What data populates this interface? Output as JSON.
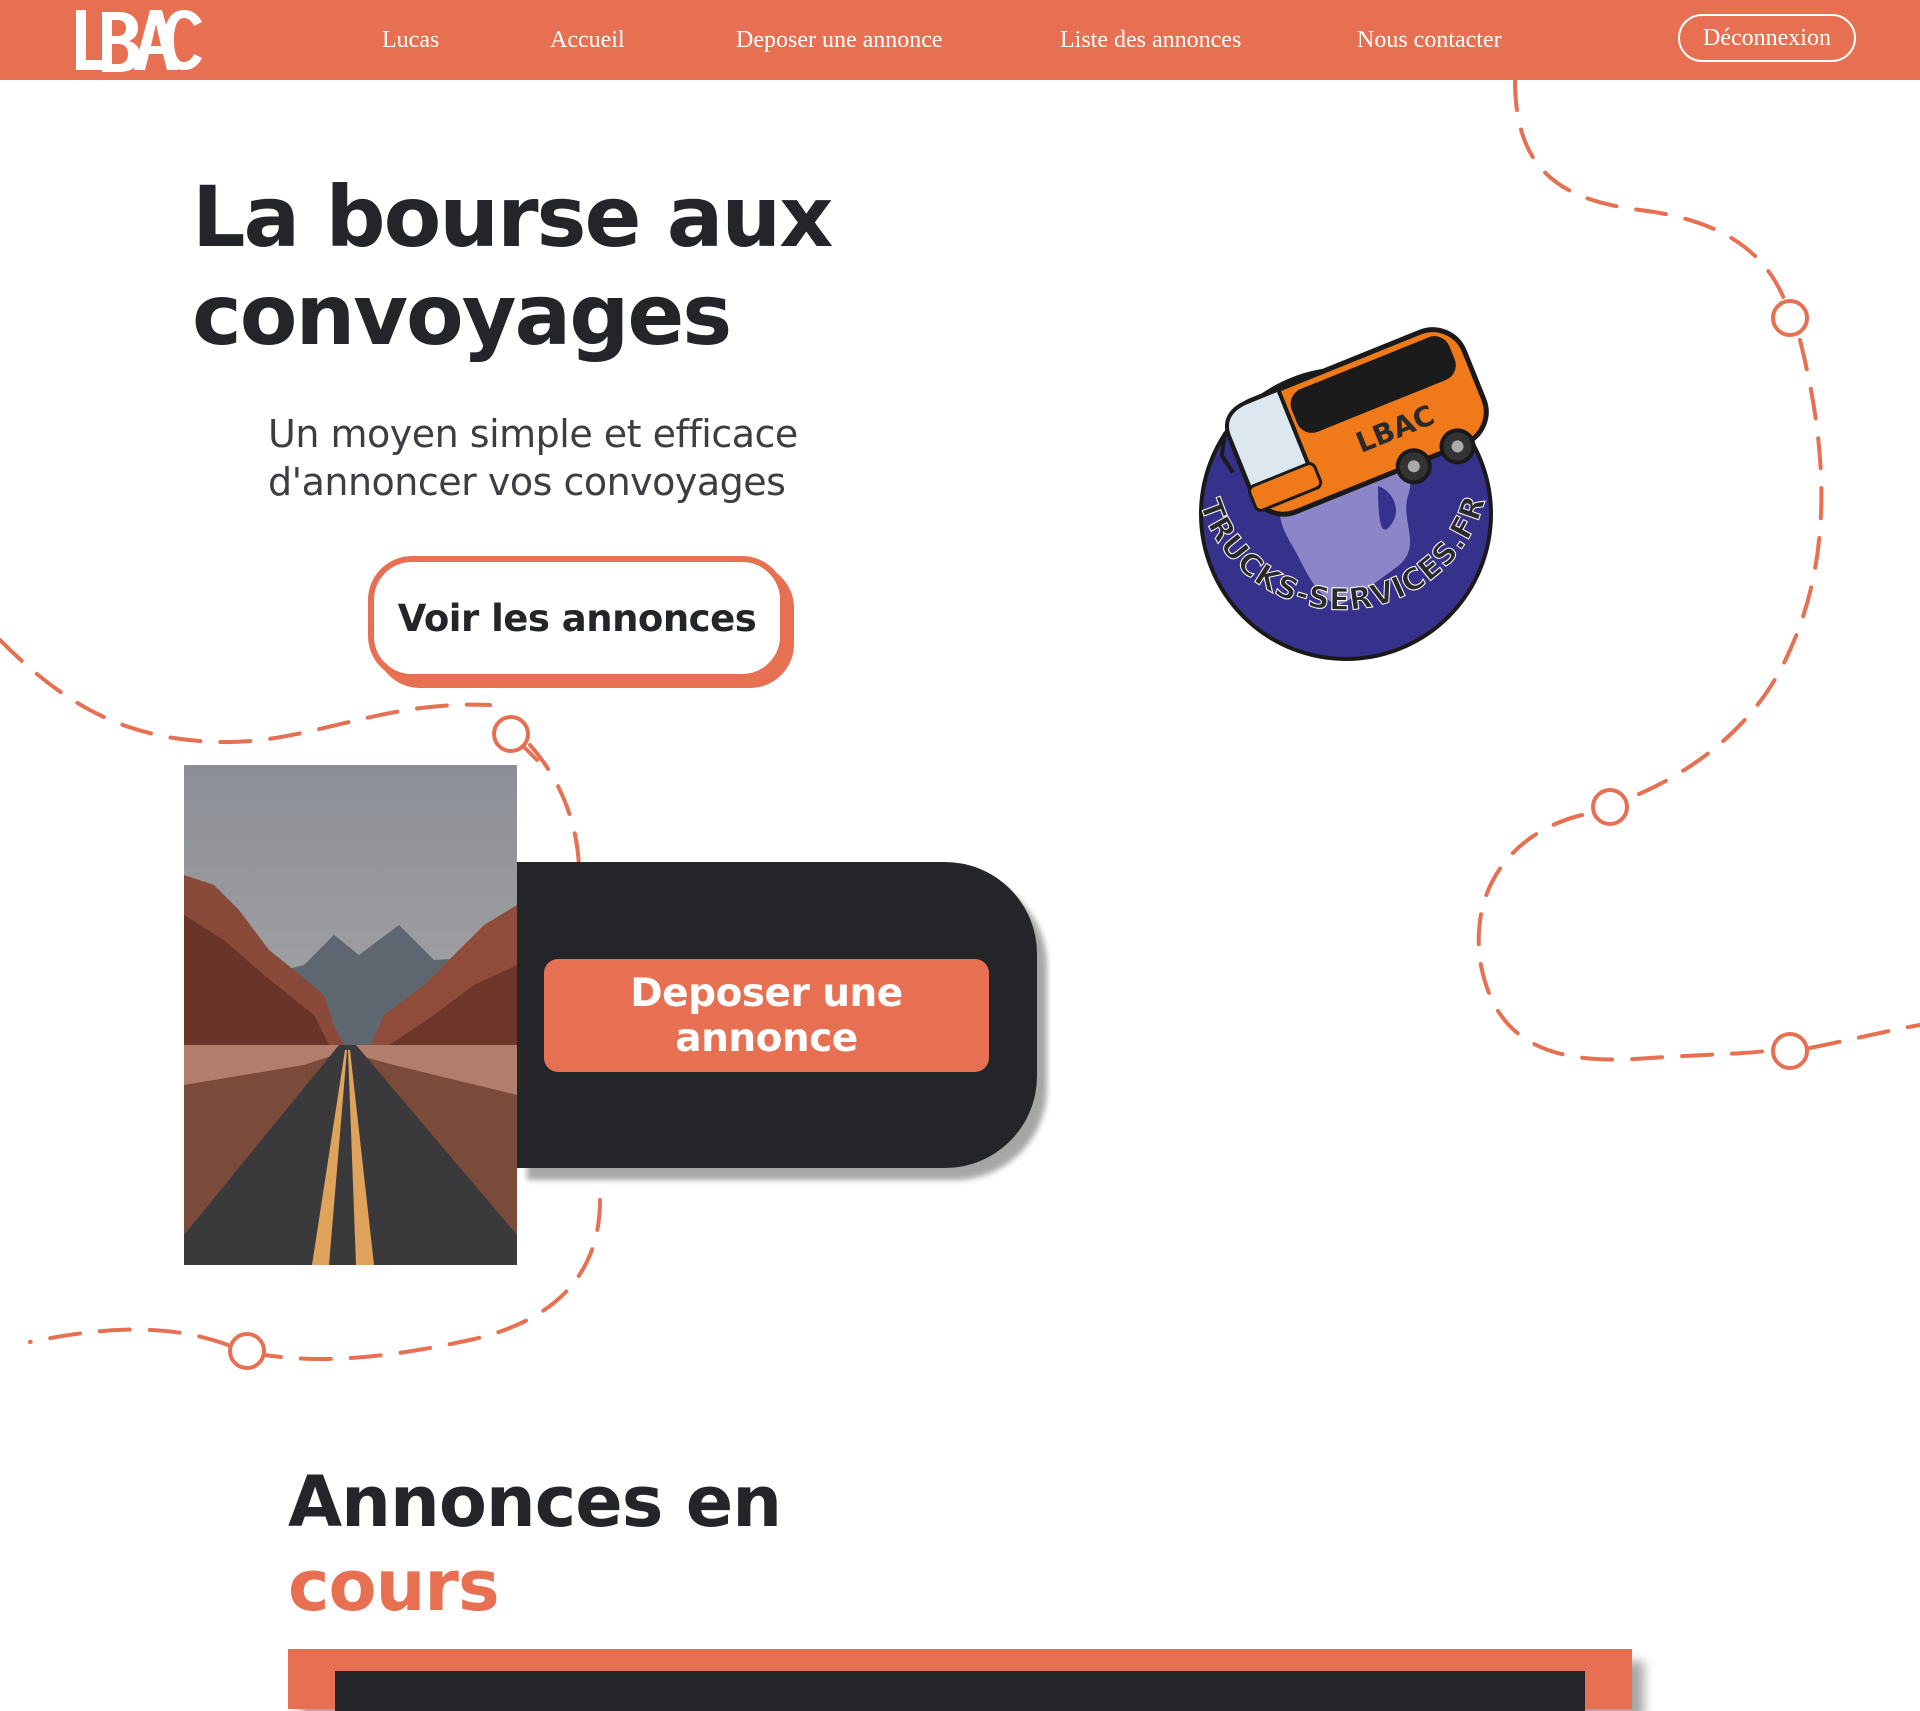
{
  "colors": {
    "accent": "#e67051",
    "dark": "#232528",
    "background": "#ffffff",
    "globe": "#36318b",
    "bus": "#f07a1a"
  },
  "header": {
    "logo_text": "LBAC",
    "nav": [
      {
        "label": "Lucas"
      },
      {
        "label": "Accueil"
      },
      {
        "label": "Deposer une annonce"
      },
      {
        "label": "Liste des annonces"
      },
      {
        "label": "Nous contacter"
      }
    ],
    "logout_label": "Déconnexion"
  },
  "hero": {
    "title": "La bourse aux convoyages",
    "subtitle": "Un moyen simple et efficace d'annoncer vos convoyages",
    "cta_label": "Voir les annonces"
  },
  "illustration": {
    "badge_text": "LBAC",
    "ring_text": "TRUCKS-SERVICES.FR",
    "icon": "bus-on-globe-logo"
  },
  "feature": {
    "photo": "desert-road-photo",
    "button_label": "Deposer une annonce"
  },
  "ads_section": {
    "title_line1": "Annonces en",
    "title_line2": "cours"
  }
}
